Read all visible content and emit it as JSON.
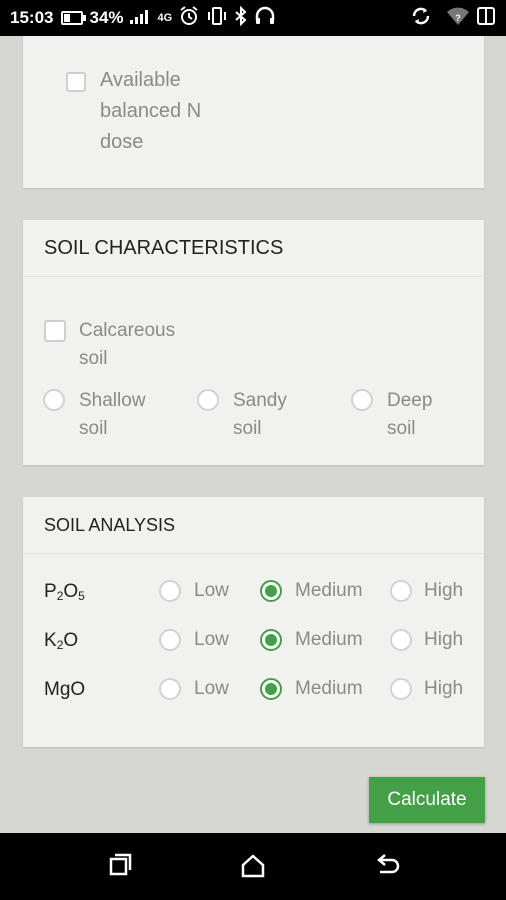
{
  "status_bar": {
    "time": "15:03",
    "battery_percent": "34%",
    "network": "4G",
    "icons": [
      "battery-icon",
      "signal-icon",
      "alarm-icon",
      "vibrate-icon",
      "bluetooth-icon",
      "headset-icon",
      "sync-icon",
      "wifi-icon",
      "dual-sim-icon"
    ]
  },
  "card_top": {
    "checkbox_label": "Available balanced N dose",
    "checkbox_label_lines": [
      "Available",
      "balanced N",
      "dose"
    ],
    "checked": false
  },
  "soil_characteristics": {
    "title": "SOIL CHARACTERISTICS",
    "calcareous": {
      "line1": "Calcareous",
      "line2": "soil",
      "checked": false
    },
    "options": [
      {
        "line1": "Shallow",
        "line2": "soil",
        "checked": false
      },
      {
        "line1": "Sandy",
        "line2": "soil",
        "checked": false
      },
      {
        "line1": "Deep",
        "line2": "soil",
        "checked": false
      }
    ]
  },
  "soil_analysis": {
    "title": "SOIL ANALYSIS",
    "rows": [
      {
        "label_base": "P",
        "sub1": "2",
        "mid": "O",
        "sub2": "5",
        "selected": "Medium"
      },
      {
        "label_base": "K",
        "sub1": "2",
        "mid": "O",
        "sub2": "",
        "selected": "Medium"
      },
      {
        "label_base": "MgO",
        "sub1": "",
        "mid": "",
        "sub2": "",
        "selected": "Medium"
      }
    ],
    "levels": [
      "Low",
      "Medium",
      "High"
    ]
  },
  "actions": {
    "calculate_label": "Calculate"
  },
  "colors": {
    "accent": "#43a047",
    "background": "#d6d6d2",
    "card": "#f1f1ef"
  },
  "nav_bar": {
    "icons": [
      "recent-apps-icon",
      "home-icon",
      "back-icon"
    ]
  }
}
